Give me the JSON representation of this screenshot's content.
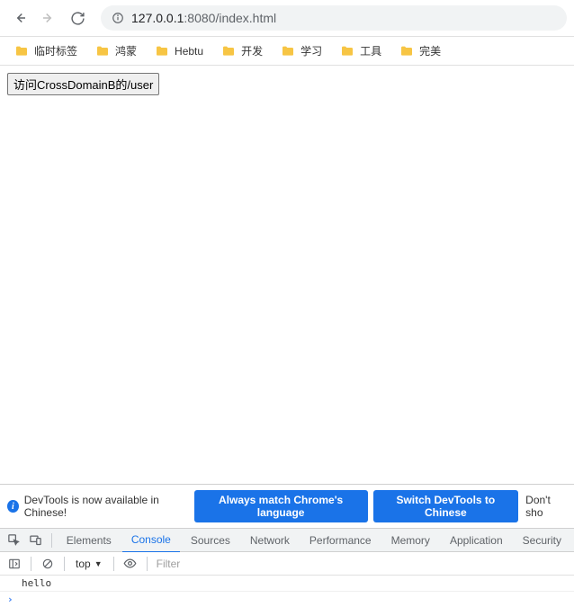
{
  "toolbar": {
    "url_host": "127.0.0.1",
    "url_port": ":8080",
    "url_path": "/index.html"
  },
  "bookmarks": [
    {
      "label": "临时标签"
    },
    {
      "label": "鸿蒙"
    },
    {
      "label": "Hebtu"
    },
    {
      "label": "开发"
    },
    {
      "label": "学习"
    },
    {
      "label": "工具"
    },
    {
      "label": "完美"
    }
  ],
  "page": {
    "button_label": "访问CrossDomainB的/user"
  },
  "banner": {
    "text": "DevTools is now available in Chinese!",
    "btn1": "Always match Chrome's language",
    "btn2": "Switch DevTools to Chinese",
    "text2": "Don't sho"
  },
  "devtools": {
    "tabs": {
      "elements": "Elements",
      "console": "Console",
      "sources": "Sources",
      "network": "Network",
      "performance": "Performance",
      "memory": "Memory",
      "application": "Application",
      "security": "Security"
    }
  },
  "console_toolbar": {
    "context": "top",
    "filter_placeholder": "Filter"
  },
  "console": {
    "log": "hello"
  }
}
